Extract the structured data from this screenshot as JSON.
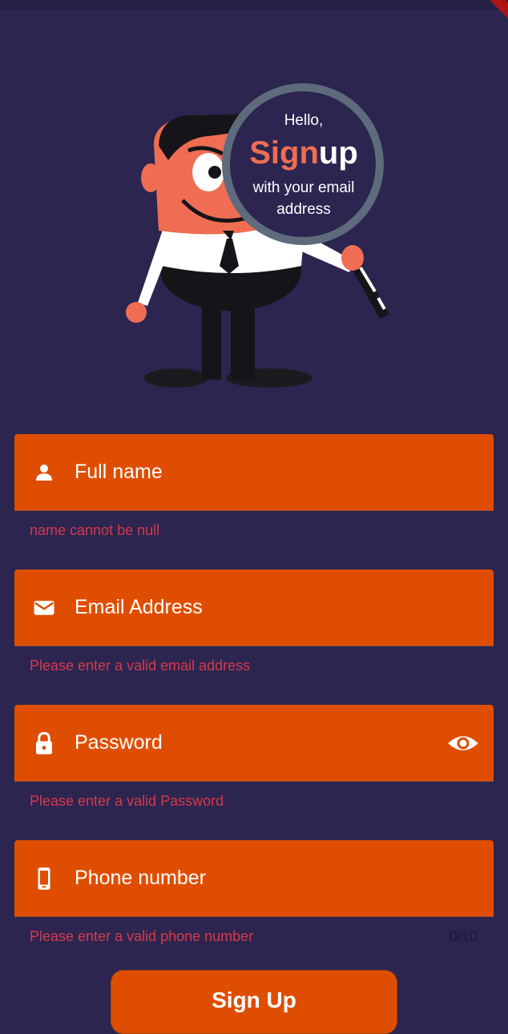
{
  "header": {
    "hello": "Hello,",
    "sign": "Sign",
    "up": "up",
    "caption_line1": "with your email",
    "caption_line2": "address"
  },
  "form": {
    "fields": [
      {
        "label": "Full name",
        "icon": "person-icon",
        "error": "name cannot be null"
      },
      {
        "label": "Email Address",
        "icon": "mail-icon",
        "error": "Please enter a valid email address"
      },
      {
        "label": "Password",
        "icon": "lock-icon",
        "error": "Please enter a valid Password",
        "trailing_icon": "eye-icon"
      },
      {
        "label": "Phone number",
        "icon": "phone-icon",
        "error": "Please enter a valid phone number",
        "counter": "0/10"
      }
    ],
    "submit_label": "Sign Up"
  },
  "colors": {
    "background": "#2b2550",
    "field": "#df4e00",
    "error": "#d8394a",
    "accent": "#ee6d53"
  }
}
